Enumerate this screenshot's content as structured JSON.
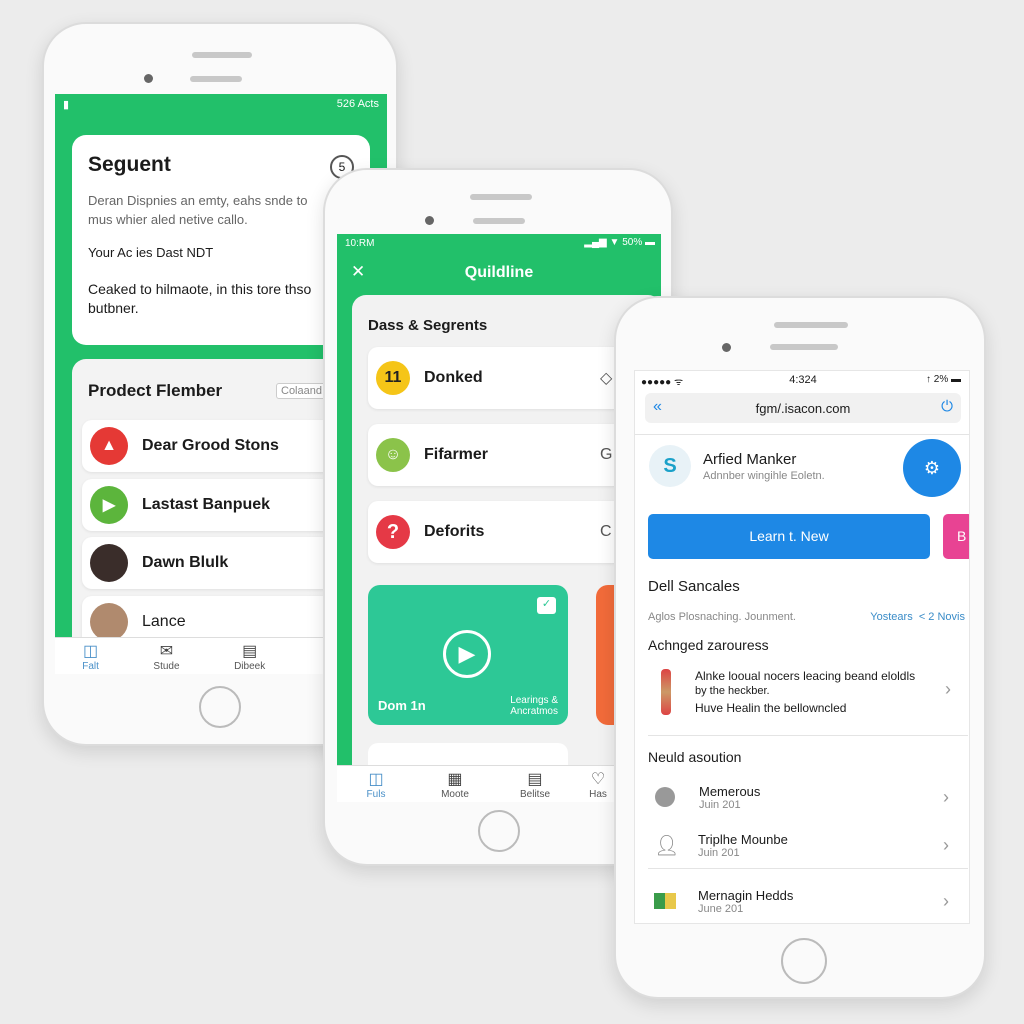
{
  "phone1": {
    "status_right": "526 Acts",
    "card": {
      "title": "Seguent",
      "desc": "Deran Dispnies an emty, eahs snde to mus whier aled netive callo.",
      "line1": "Your Ac ies Dast NDT",
      "line2": "Ceaked to hilmaote, in this tore thso butbner."
    },
    "panel": {
      "title": "Prodect Flember",
      "chip": "Colaand",
      "items": [
        {
          "label": "Dear Grood Stons",
          "color": "#e53935"
        },
        {
          "label": "Lastast Banpuek",
          "color": "#5cb53c"
        },
        {
          "label": "Dawn Blulk",
          "color": "#3a2d2a"
        },
        {
          "label": "Lance",
          "color": "#b08a6e"
        }
      ]
    },
    "nav": [
      {
        "label": "Falt",
        "icon": "columns-icon"
      },
      {
        "label": "Stude",
        "icon": "chat-icon"
      },
      {
        "label": "Dibeek",
        "icon": "book-icon"
      }
    ]
  },
  "phone2": {
    "status_left": "10:RM",
    "status_right": "50%",
    "title": "Quildline",
    "section": "Dass & Segrents",
    "items": [
      {
        "label": "Donked",
        "icon_text": "11",
        "color": "#f5c518",
        "trail": "◇"
      },
      {
        "label": "Fifarmer",
        "icon_text": "☺",
        "color": "#8bc34a",
        "trail": "G"
      },
      {
        "label": "Deforits",
        "icon_text": "?",
        "color": "#e53946",
        "trail": "C"
      }
    ],
    "media": {
      "left": "Dom 1n",
      "right": "Learings & Ancratmos"
    },
    "nav": [
      {
        "label": "Fuls",
        "icon": "columns-icon"
      },
      {
        "label": "Moote",
        "icon": "calendar-icon"
      },
      {
        "label": "Belitse",
        "icon": "book-icon"
      },
      {
        "label": "Has",
        "icon": "heart-icon"
      }
    ]
  },
  "phone3": {
    "status_time": "4:324",
    "status_right": "2%",
    "url": "fgm/.isacon.com",
    "profile": {
      "name": "Arfied Manker",
      "sub": "Adnnber wingihle Eoletn."
    },
    "learn_button": "Learn t. New",
    "pink_button": "B",
    "section1": "Dell Sancales",
    "meta": {
      "left": "Aglos Plosnaching. Jounment.",
      "link": "Yostears",
      "count": "< 2 Novis"
    },
    "section2": "Achnged zarouress",
    "feature": {
      "l1": "Alnke looual nocers leacing beand eloldls",
      "l2": "by the heckber.",
      "l3": "Huve Healin the bellowncled"
    },
    "section3": "Neuld asoution",
    "items": [
      {
        "title": "Memerous",
        "date": "Juin 201"
      },
      {
        "title": "Triplhe Mounbe",
        "date": "Juin 201"
      },
      {
        "title": "Mernagin Hedds",
        "date": "June 201"
      }
    ],
    "colors": {
      "blue": "#1e88e5",
      "pink": "#e84393"
    }
  }
}
